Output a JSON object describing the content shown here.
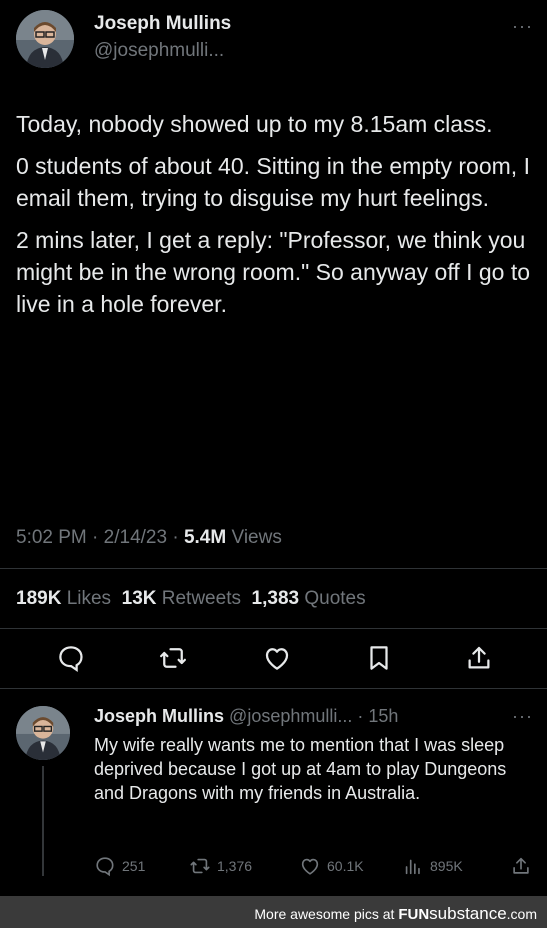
{
  "tweet": {
    "author_name": "Joseph Mullins",
    "author_handle": "@josephmulli...",
    "more": "···",
    "paragraphs": [
      "Today, nobody showed up to my 8.15am class.",
      "0 students of about 40.  Sitting in the empty room, I email them, trying to disguise my hurt feelings.",
      "2 mins later, I get a reply: \"Professor, we think you might be in the wrong room.\" So anyway off I go to live in a hole forever."
    ],
    "time": "5:02 PM",
    "date": "2/14/23",
    "sep": "·",
    "views_count": "5.4M",
    "views_label": "Views",
    "likes_count": "189K",
    "likes_label": "Likes",
    "retweets_count": "13K",
    "retweets_label": "Retweets",
    "quotes_count": "1,383",
    "quotes_label": "Quotes",
    "actions": [
      "reply-icon",
      "retweet-icon",
      "like-icon",
      "bookmark-icon",
      "share-icon"
    ]
  },
  "reply": {
    "author_name": "Joseph Mullins",
    "author_handle": "@josephmulli...",
    "age": "· 15h",
    "more": "···",
    "text": "My wife really wants me to mention that I was sleep deprived because I got up at 4am to play Dungeons and Dragons with my friends in Australia.",
    "reply_count": "251",
    "retweet_count": "1,376",
    "like_count": "60.1K",
    "views_count": "895K"
  },
  "footer": {
    "text_prefix": "More awesome pics at ",
    "brand_fun": "FUN",
    "brand_rest": "substance",
    "brand_suffix": ".com"
  },
  "colors": {
    "background": "#000000",
    "primary_text": "#e7e9ea",
    "secondary_text": "#71767b",
    "divider": "#2f3336"
  }
}
